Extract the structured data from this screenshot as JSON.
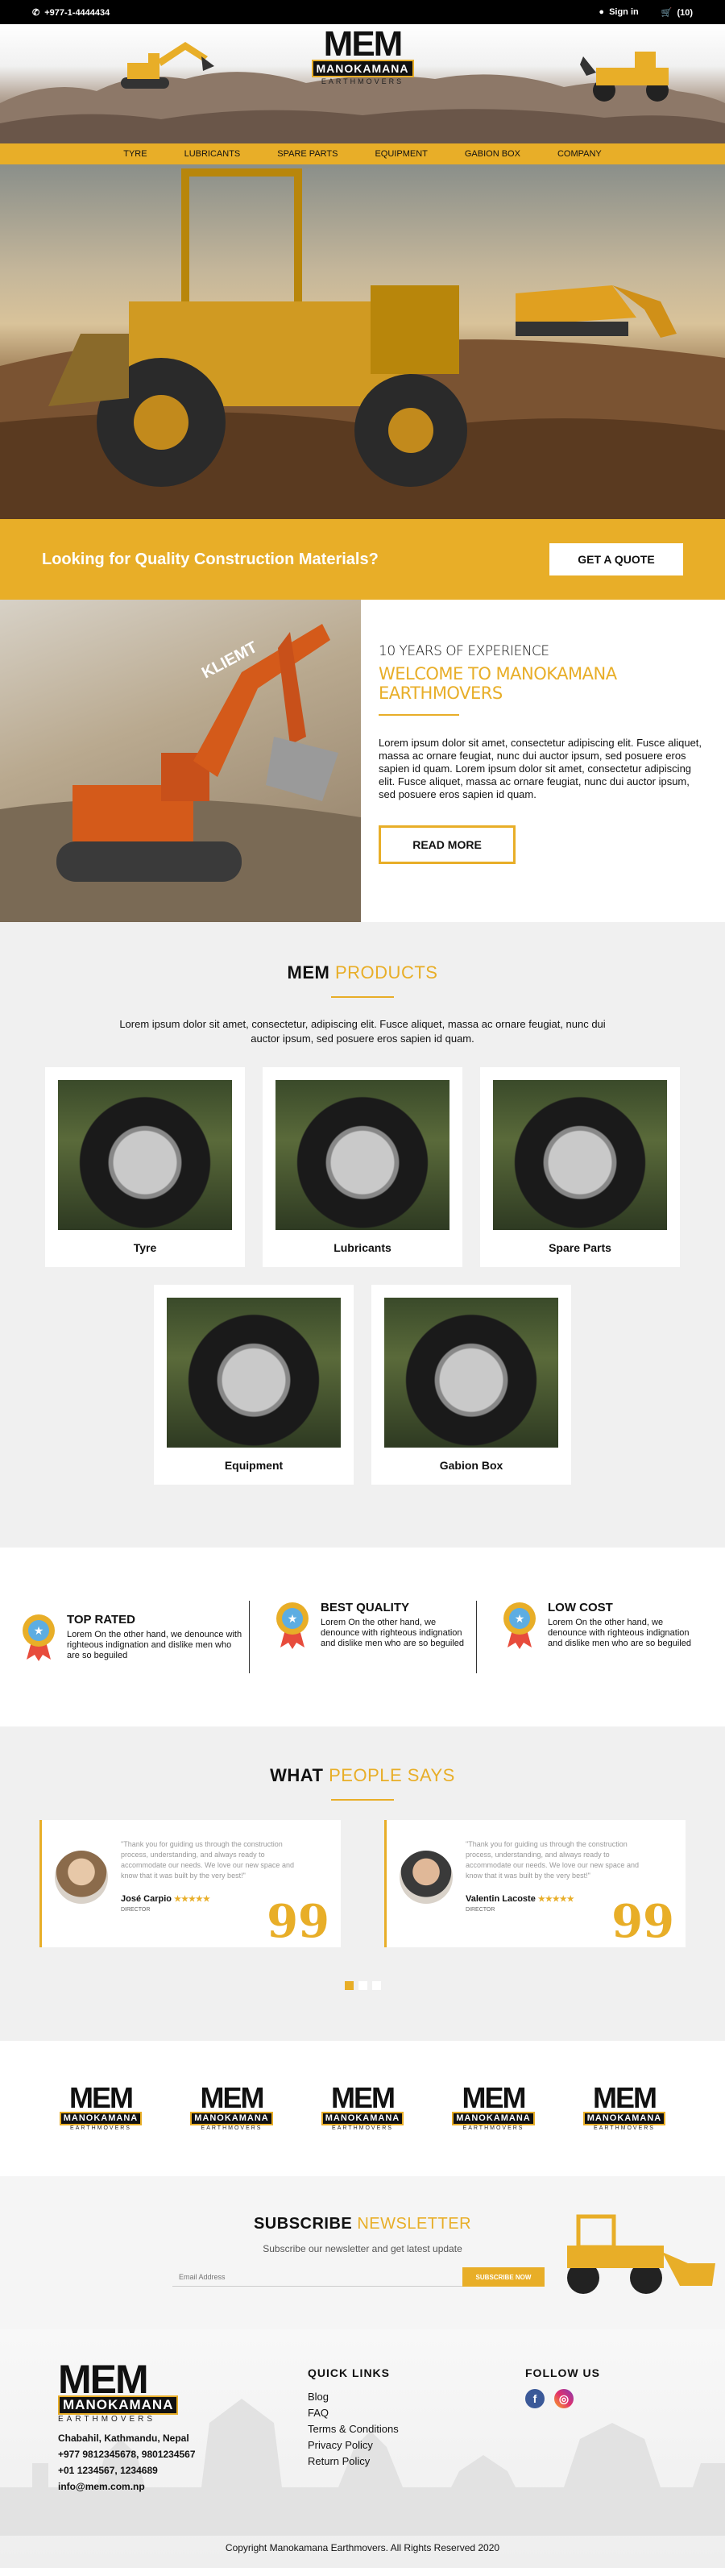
{
  "topbar": {
    "phone": "+977-1-4444434",
    "signin": "Sign in",
    "cart": "(10)"
  },
  "brand": {
    "mem": "MEM",
    "mano": "MANOKAMANA",
    "earth": "EARTHMOVERS"
  },
  "nav": [
    "TYRE",
    "LUBRICANTS",
    "SPARE PARTS",
    "EQUIPMENT",
    "GABION BOX",
    "COMPANY"
  ],
  "quote": {
    "text": "Looking for Quality Construction Materials?",
    "button": "GET A QUOTE"
  },
  "about": {
    "experience": "10 YEARS OF EXPERIENCE",
    "welcome": "WELCOME TO MANOKAMANA EARTHMOVERS",
    "body": "Lorem ipsum dolor sit amet, consectetur adipiscing elit. Fusce aliquet, massa ac ornare feugiat, nunc dui auctor ipsum, sed posuere eros sapien id quam. Lorem ipsum dolor sit amet, consectetur adipiscing elit. Fusce aliquet, massa ac ornare feugiat, nunc dui auctor ipsum, sed posuere eros sapien id quam.",
    "button": "READ MORE",
    "machine_label": "KLIEMT"
  },
  "products": {
    "title_a": "MEM",
    "title_b": "PRODUCTS",
    "desc": "Lorem ipsum dolor sit amet, consectetur, adipiscing elit. Fusce aliquet, massa ac ornare feugiat, nunc dui auctor ipsum, sed posuere eros sapien id quam.",
    "items": [
      "Tyre",
      "Lubricants",
      "Spare Parts",
      "Equipment",
      "Gabion Box"
    ]
  },
  "features": [
    {
      "title": "TOP RATED",
      "text": "Lorem On the other hand, we denounce with righteous indignation and dislike men who are so beguiled"
    },
    {
      "title": "BEST QUALITY",
      "text": "Lorem On the other hand, we denounce with righteous indignation and dislike men who are so beguiled"
    },
    {
      "title": "LOW COST",
      "text": "Lorem On the other hand, we denounce with righteous indignation and dislike men who are so beguiled"
    }
  ],
  "testimonials": {
    "title_a": "WHAT",
    "title_b": "PEOPLE SAYS",
    "items": [
      {
        "quote": "\"Thank you for guiding us through the construction process, understanding, and always ready to accommodate our needs. We love our new space and know that it was built by the very best!\"",
        "name": "José Carpio",
        "stars": "★★★★★",
        "role": "DIRECTOR"
      },
      {
        "quote": "\"Thank you for guiding us through the construction process, understanding, and always ready to accommodate our needs. We love our new space and know that it was built by the very best!\"",
        "name": "Valentin Lacoste",
        "stars": "★★★★★",
        "role": "DIRECTOR"
      }
    ],
    "quote_mark": "99"
  },
  "subscribe": {
    "title_a": "SUBSCRIBE",
    "title_b": "NEWSLETTER",
    "sub": "Subscribe our newsletter and get latest update",
    "placeholder": "Email Address",
    "button": "SUBSCRIBE NOW"
  },
  "footer": {
    "address": "Chabahil, Kathmandu, Nepal",
    "phone1": "+977 9812345678, 9801234567",
    "phone2": "+01 1234567, 1234689",
    "email": "info@mem.com.np",
    "quick_title": "QUICK LINKS",
    "links": [
      "Blog",
      "FAQ",
      "Terms & Conditions",
      "Privacy Policy",
      "Return Policy"
    ],
    "follow_title": "FOLLOW US",
    "copyright": "Copyright Manokamana Earthmovers. All Rights Reserved 2020"
  },
  "colors": {
    "accent": "#e8ae28",
    "dark": "#111111",
    "light_bg": "#f0f0f0"
  },
  "icons": [
    "phone-icon",
    "user-icon",
    "cart-icon",
    "facebook-icon",
    "instagram-icon",
    "medal-icon"
  ]
}
